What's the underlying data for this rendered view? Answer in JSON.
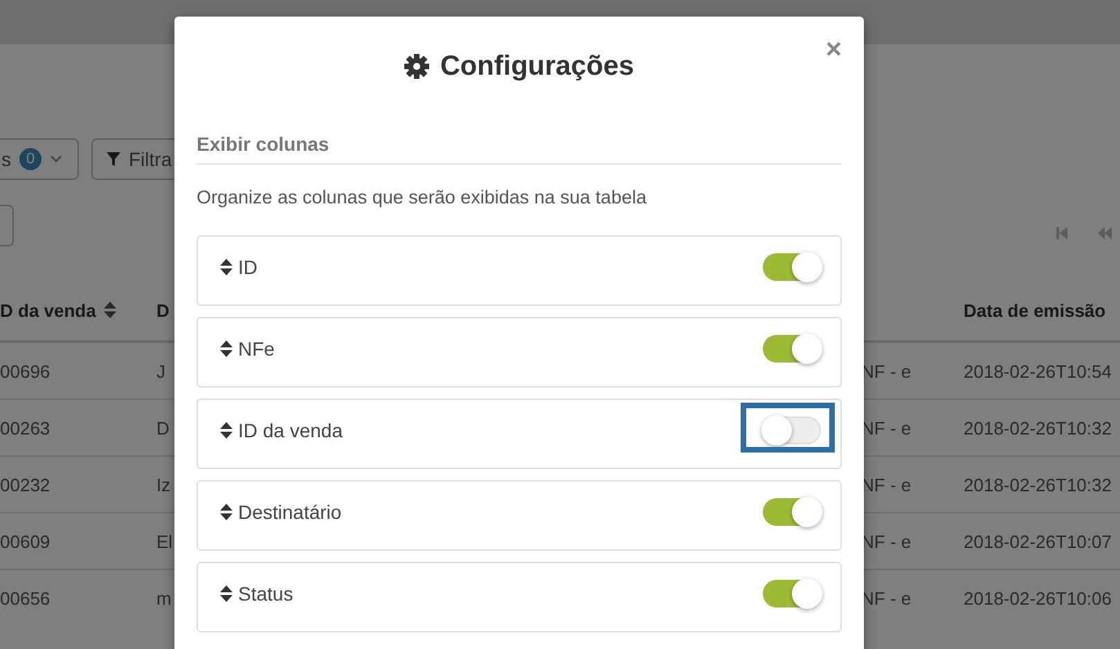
{
  "background": {
    "toolbar": {
      "count_button": {
        "label": "s",
        "badge": "0"
      },
      "filter_button": {
        "label": "Filtra"
      }
    },
    "table": {
      "columns": [
        "D da venda",
        "D",
        "",
        "Data de emissão"
      ],
      "rows": [
        [
          "00696",
          "J",
          "NF - e",
          "2018-02-26T10:54"
        ],
        [
          "00263",
          "D",
          "NF - e",
          "2018-02-26T10:32"
        ],
        [
          "00232",
          "Iz",
          "NF - e",
          "2018-02-26T10:32"
        ],
        [
          "00609",
          "El",
          "NF - e",
          "2018-02-26T10:07"
        ],
        [
          "00656",
          "m",
          "NF - e",
          "2018-02-26T10:06"
        ]
      ]
    }
  },
  "dialog": {
    "title": "Configurações",
    "close": "×",
    "section": "Exibir colunas",
    "description": "Organize as colunas que serão exibidas na sua tabela",
    "columns": [
      {
        "label": "ID",
        "on": true,
        "highlighted": false
      },
      {
        "label": "NFe",
        "on": true,
        "highlighted": false
      },
      {
        "label": "ID da venda",
        "on": false,
        "highlighted": true
      },
      {
        "label": "Destinatário",
        "on": true,
        "highlighted": false
      },
      {
        "label": "Status",
        "on": true,
        "highlighted": false
      }
    ]
  }
}
